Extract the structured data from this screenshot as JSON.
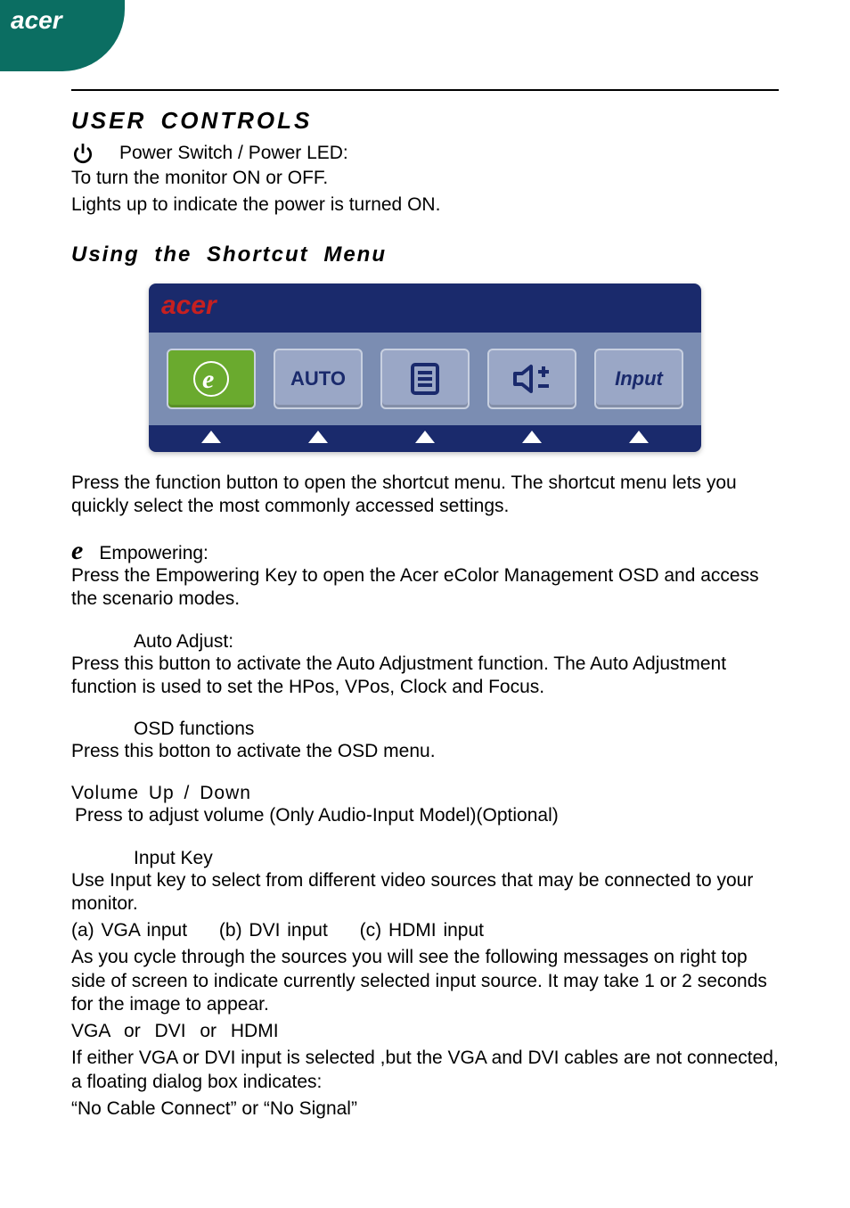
{
  "brand": "acer",
  "heading1": "USER CONTROLS",
  "power": {
    "label": "Power Switch / Power LED:",
    "line1": "To turn the monitor ON or OFF.",
    "line2": "Lights up to indicate the power is turned ON."
  },
  "heading2": "Using  the Shortcut Menu",
  "osd": {
    "e_label": "e",
    "auto_label": "AUTO",
    "input_label": "Input"
  },
  "shortcut_intro": "Press the function button to open the shortcut menu. The shortcut menu lets you quickly select the most commonly accessed settings.",
  "empowering": {
    "icon": "e",
    "title": "Empowering:",
    "body": "Press the Empowering Key to open the Acer eColor Management OSD and access the scenario modes."
  },
  "auto": {
    "title": "Auto Adjust:",
    "body": "Press this button to activate the Auto Adjustment function. The Auto Adjustment function is used to set the HPos, VPos, Clock and Focus."
  },
  "osd_functions": {
    "title": "OSD functions",
    "body": "Press this botton to activate the OSD menu."
  },
  "volume": {
    "title": "Volume Up / Down",
    "body": " Press to adjust volume (Only Audio-Input Model)(Optional)"
  },
  "input_key": {
    "title": "Input Key",
    "body1": "Use Input key to select from different video sources that may be connected to your monitor.",
    "opts": {
      "a": "(a) VGA input",
      "b": "(b) DVI input",
      "c": "(c) HDMI input"
    },
    "body2": "As you cycle through the sources you will see the following messages on right top side of screen to indicate currently selected input source. It may take 1 or 2 seconds for the image to appear.",
    "line_sources": "VGA  or  DVI  or  HDMI",
    "body3": "If either VGA or DVI input is selected ,but the VGA and DVI cables are not connected, a floating dialog box indicates:",
    "body4": "“No Cable Connect” or “No Signal”"
  }
}
